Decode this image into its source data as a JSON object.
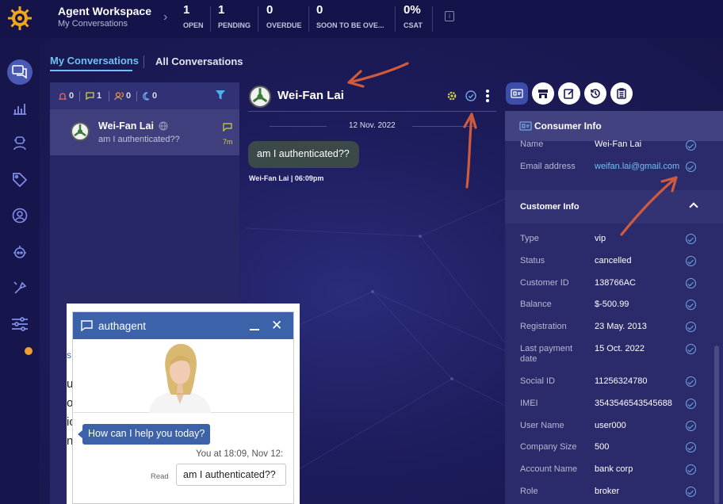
{
  "header": {
    "title": "Agent Workspace",
    "subtitle": "My Conversations",
    "stats": [
      {
        "value": "1",
        "label": "OPEN"
      },
      {
        "value": "1",
        "label": "PENDING"
      },
      {
        "value": "0",
        "label": "OVERDUE"
      },
      {
        "value": "0",
        "label": "SOON TO BE OVE..."
      },
      {
        "value": "0%",
        "label": "CSAT"
      }
    ]
  },
  "sidebar": {
    "icons": [
      "conversations-icon",
      "analytics-icon",
      "agent-icon",
      "tag-icon",
      "user-icon",
      "bot-icon",
      "settings-icon",
      "sliders-icon"
    ],
    "notification_color": "#f0a030"
  },
  "tabs": {
    "my_conversations": "My Conversations",
    "all_conversations": "All Conversations"
  },
  "conversation_list": {
    "counts": {
      "alerts": "0",
      "messages": "1",
      "users": "0",
      "pending": "0"
    },
    "items": [
      {
        "name": "Wei-Fan Lai",
        "preview": "am I authenticated??",
        "time": "7m"
      }
    ]
  },
  "chat": {
    "contact_name": "Wei-Fan Lai",
    "date_label": "12 Nov. 2022",
    "message": "am I authenticated??",
    "message_meta": "Wei-Fan Lai  |  06:09pm"
  },
  "consumer_info": {
    "title": "Consumer Info",
    "rows": [
      {
        "label": "Name",
        "value": "Wei-Fan Lai"
      },
      {
        "label": "Email address",
        "value": "weifan.lai@gmail.com"
      }
    ]
  },
  "customer_info": {
    "title": "Customer Info",
    "rows": [
      {
        "label": "Type",
        "value": "vip"
      },
      {
        "label": "Status",
        "value": "cancelled"
      },
      {
        "label": "Customer ID",
        "value": "138766AC"
      },
      {
        "label": "Balance",
        "value": "$-500.99"
      },
      {
        "label": "Registration",
        "value": "23 May. 2013"
      },
      {
        "label": "Last payment date",
        "value": "15 Oct. 2022"
      },
      {
        "label": "Social ID",
        "value": "11256324780"
      },
      {
        "label": "IMEI",
        "value": "3543546543545688"
      },
      {
        "label": "User Name",
        "value": "user000"
      },
      {
        "label": "Company Size",
        "value": "500"
      },
      {
        "label": "Account Name",
        "value": "bank corp"
      },
      {
        "label": "Role",
        "value": "broker"
      }
    ]
  },
  "chat_widget": {
    "title": "authagent",
    "greeting": "How can I help you today?",
    "you_at": "You at 18:09, Nov 12:",
    "read_label": "Read",
    "user_message": "am I authenticated??",
    "partial_chars": [
      "s",
      "u",
      "o",
      "ic",
      "n"
    ],
    "accent": "#3c62a9"
  }
}
